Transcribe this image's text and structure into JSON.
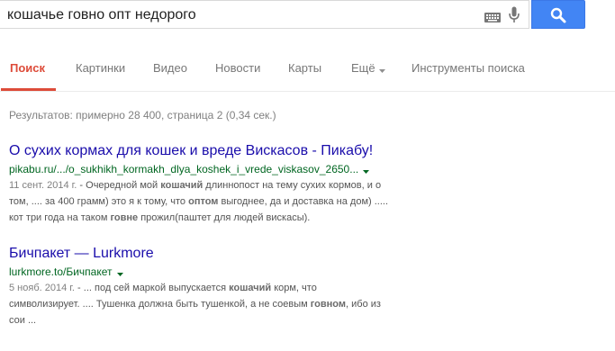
{
  "search": {
    "query": "кошачье говно опт недорого"
  },
  "tabs": [
    {
      "label": "Поиск"
    },
    {
      "label": "Картинки"
    },
    {
      "label": "Видео"
    },
    {
      "label": "Новости"
    },
    {
      "label": "Карты"
    },
    {
      "label": "Ещё"
    },
    {
      "label": "Инструменты поиска"
    }
  ],
  "stats": "Результатов: примерно 28 400, страница 2 (0,34 сек.)",
  "results": [
    {
      "title": "О сухих кормах для кошек и вреде Вискасов - Пикабу!",
      "url": "pikabu.ru/.../o_sukhikh_kormakh_dlya_koshek_i_vrede_viskasov_2650...",
      "line1": {
        "date": "11 сент. 2014 г.",
        "a": " - Очередной мой ",
        "b1": "кошачий",
        "c": " длиннопост на тему сухих кормов, и о"
      },
      "line2": {
        "a": "том, .... за 400 грамм) это я к тому, что ",
        "b1": "оптом",
        "c": " выгоднее, да и доставка на дом) ....."
      },
      "line3": {
        "a": "кот три года на таком ",
        "b1": "говне",
        "c": " прожил(паштет для людей вискасы)."
      }
    },
    {
      "title": "Бичпакет — Lurkmore",
      "url": "lurkmore.to/Бичпакет",
      "line1": {
        "date": "5 нояб. 2014 г.",
        "a": " - ... под сей маркой выпускается ",
        "b1": "кошачий",
        "c": " корм, что"
      },
      "line2": {
        "a": "символизирует. .... Тушенка должна быть тушенкой, а не соевым ",
        "b1": "говном",
        "c": ", ибо из"
      },
      "line3": {
        "a": "сои ..."
      }
    }
  ]
}
